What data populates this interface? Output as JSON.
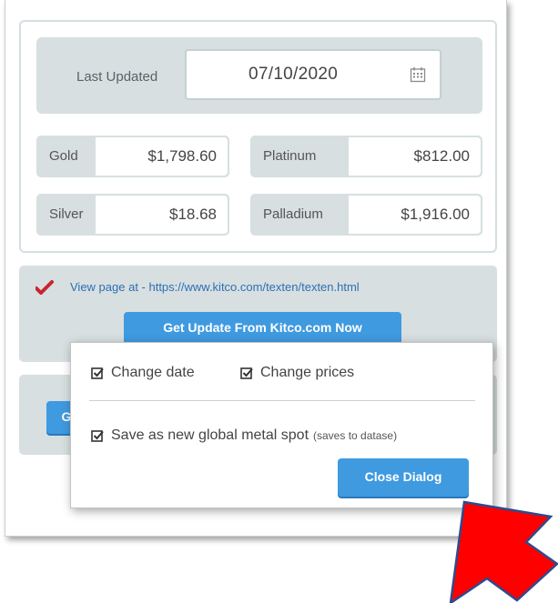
{
  "date": {
    "label": "Last Updated",
    "value": "07/10/2020",
    "icon": "calendar-icon"
  },
  "prices": [
    {
      "label": "Gold",
      "value": "$1,798.60"
    },
    {
      "label": "Platinum",
      "value": "$812.00"
    },
    {
      "label": "Silver",
      "value": "$18.68"
    },
    {
      "label": "Palladium",
      "value": "$1,916.00"
    }
  ],
  "kitco": {
    "link": "View page at - https://www.kitco.com/texten/texten.html",
    "button": "Get Update From Kitco.com Now"
  },
  "lower": {
    "button_partial": "G"
  },
  "dialog": {
    "change_date": "Change date",
    "change_prices": "Change prices",
    "save_global": "Save as new global metal spot",
    "save_note": "(saves to datase)",
    "close": "Close Dialog"
  },
  "colors": {
    "panel_bg": "#d7dfe1",
    "button_blue": "#3f9ae0",
    "link_blue": "#2f6fb3",
    "arrow_red": "#ff0000",
    "arrow_outline": "#2e4a8f"
  }
}
